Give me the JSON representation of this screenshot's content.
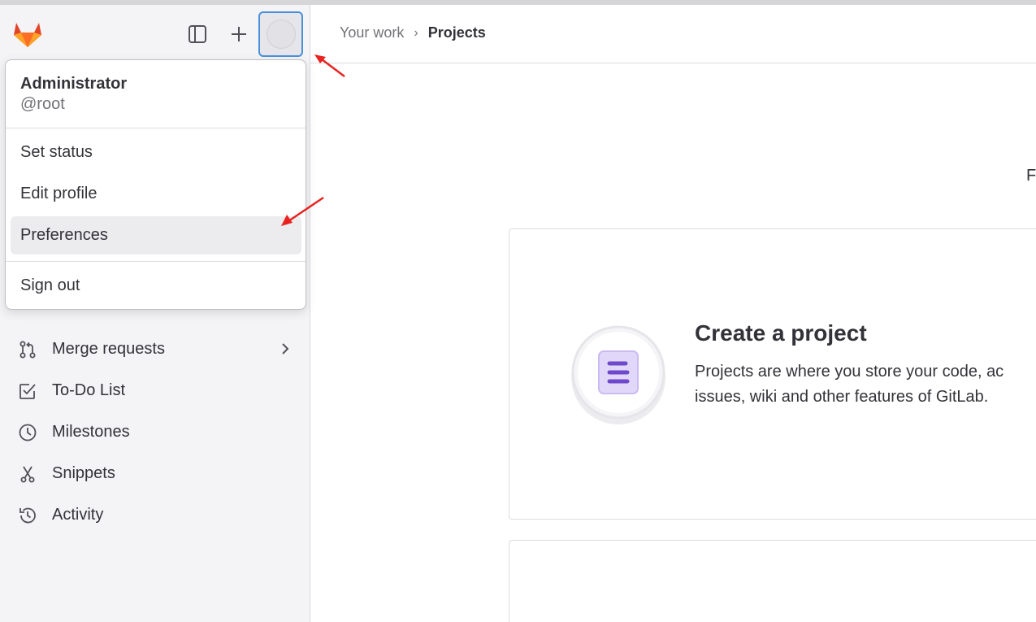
{
  "colors": {
    "sidebar_bg": "#f4f4f6",
    "focus_ring": "#4a90d9",
    "arrow": "#e8231f",
    "project_icon": "#6e49cb"
  },
  "sidebar": {
    "nav": [
      {
        "label": "Merge requests",
        "icon": "merge-request-icon",
        "has_chevron": true
      },
      {
        "label": "To-Do List",
        "icon": "todo-icon"
      },
      {
        "label": "Milestones",
        "icon": "clock-icon"
      },
      {
        "label": "Snippets",
        "icon": "scissors-icon"
      },
      {
        "label": "Activity",
        "icon": "history-icon"
      }
    ]
  },
  "header": {
    "breadcrumb": {
      "parent": "Your work",
      "separator": "›",
      "current": "Projects"
    },
    "edge_text": "F"
  },
  "user_menu": {
    "name": "Administrator",
    "handle": "@root",
    "items": [
      {
        "label": "Set status"
      },
      {
        "label": "Edit profile"
      },
      {
        "label": "Preferences",
        "highlighted": true
      },
      {
        "label": "Sign out"
      }
    ]
  },
  "main": {
    "create_card": {
      "title": "Create a project",
      "desc_line1": "Projects are where you store your code, ac",
      "desc_line2": "issues, wiki and other features of GitLab."
    }
  }
}
